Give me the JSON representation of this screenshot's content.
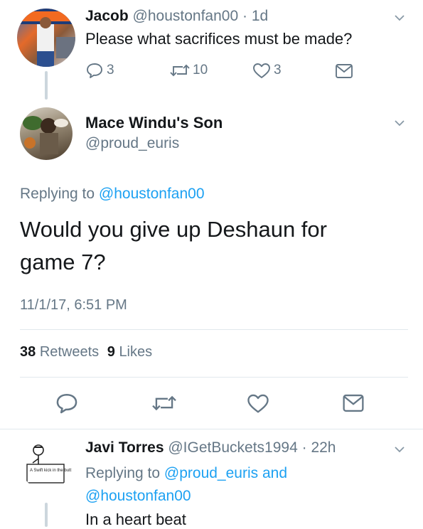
{
  "tweet1": {
    "name": "Jacob",
    "handle": "@houstonfan00",
    "time": "1d",
    "text": "Please what sacrifices must be made?",
    "replies": "3",
    "retweets": "10",
    "likes": "3"
  },
  "main": {
    "name": "Mace Windu's Son",
    "handle": "@proud_euris",
    "replying_prefix": "Replying to",
    "replying_handle": "@houstonfan00",
    "text_line1": "Would you give up Deshaun for",
    "text_line2": "game 7?",
    "timestamp": "11/1/17, 6:51 PM",
    "retweet_count": "38",
    "retweet_label": "Retweets",
    "like_count": "9",
    "like_label": "Likes"
  },
  "tweet3": {
    "name": "Javi Torres",
    "handle": "@IGetBuckets1994",
    "time": "22h",
    "replying_prefix": "Replying to",
    "replying_handle1": "@proud_euris",
    "replying_and": "and",
    "replying_handle2": "@houstonfan00",
    "text": "In a heart beat",
    "avatar_sign_text": "A Swift kick in the butt"
  },
  "colors": {
    "link": "#1da1f2",
    "muted": "#657786",
    "divider": "#e1e8ed"
  }
}
